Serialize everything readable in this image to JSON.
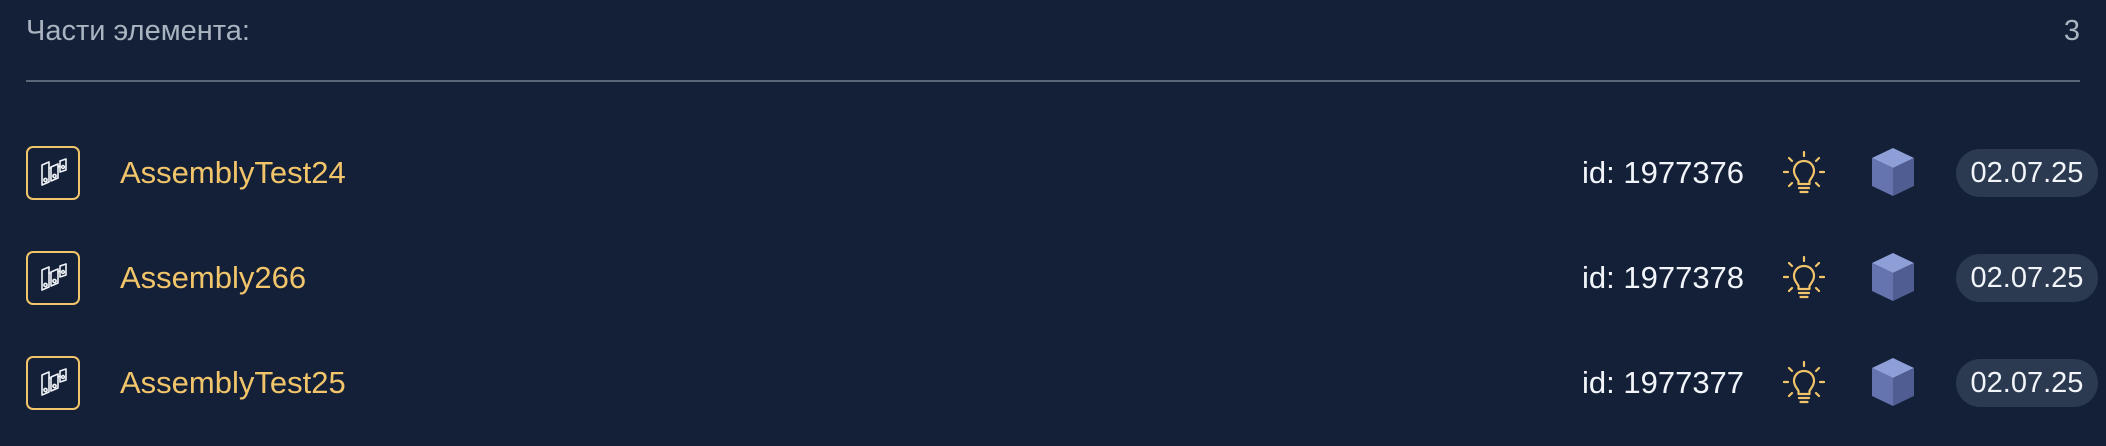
{
  "header": {
    "title": "Части элемента:",
    "count": "3"
  },
  "items": [
    {
      "name": "AssemblyTest24",
      "id_label": "id: 1977376",
      "date": "02.07.25",
      "type_icon": "assembly-icon",
      "status_icon": "lightbulb-icon",
      "model_icon": "cube-icon"
    },
    {
      "name": "Assembly266",
      "id_label": "id: 1977378",
      "date": "02.07.25",
      "type_icon": "assembly-icon",
      "status_icon": "lightbulb-icon",
      "model_icon": "cube-icon"
    },
    {
      "name": "AssemblyTest25",
      "id_label": "id: 1977377",
      "date": "02.07.25",
      "type_icon": "assembly-icon",
      "status_icon": "lightbulb-icon",
      "model_icon": "cube-icon"
    }
  ],
  "colors": {
    "background": "#132037",
    "accent": "#f2c56a",
    "text": "#f2f5fa",
    "muted_text": "#aab3c0",
    "divider": "#5b6678",
    "badge_background": "#2b3a50",
    "cube_top": "#8e9fd8",
    "cube_left": "#6574ae",
    "cube_right": "#4f5d92"
  }
}
